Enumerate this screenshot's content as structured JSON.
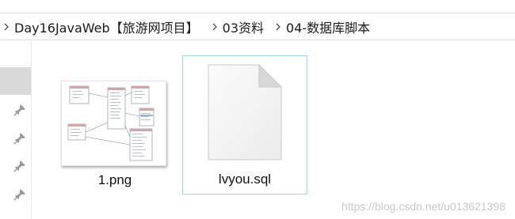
{
  "breadcrumb": {
    "items": [
      {
        "label": "Day16JavaWeb【旅游网项目】"
      },
      {
        "label": "03资料"
      },
      {
        "label": "04-数据库脚本"
      }
    ]
  },
  "nav": {
    "pinned_count": 4
  },
  "files": [
    {
      "name": "1.png",
      "icon": "image-thumbnail-icon",
      "selected": false
    },
    {
      "name": "lvyou.sql",
      "icon": "document-file-icon",
      "selected": true
    }
  ],
  "watermark": "https://blog.csdn.net/u013621398",
  "colors": {
    "selection_border": "#99d1ff",
    "nav_selected": "#d9d9d9",
    "pin": "#9a9a9a"
  }
}
